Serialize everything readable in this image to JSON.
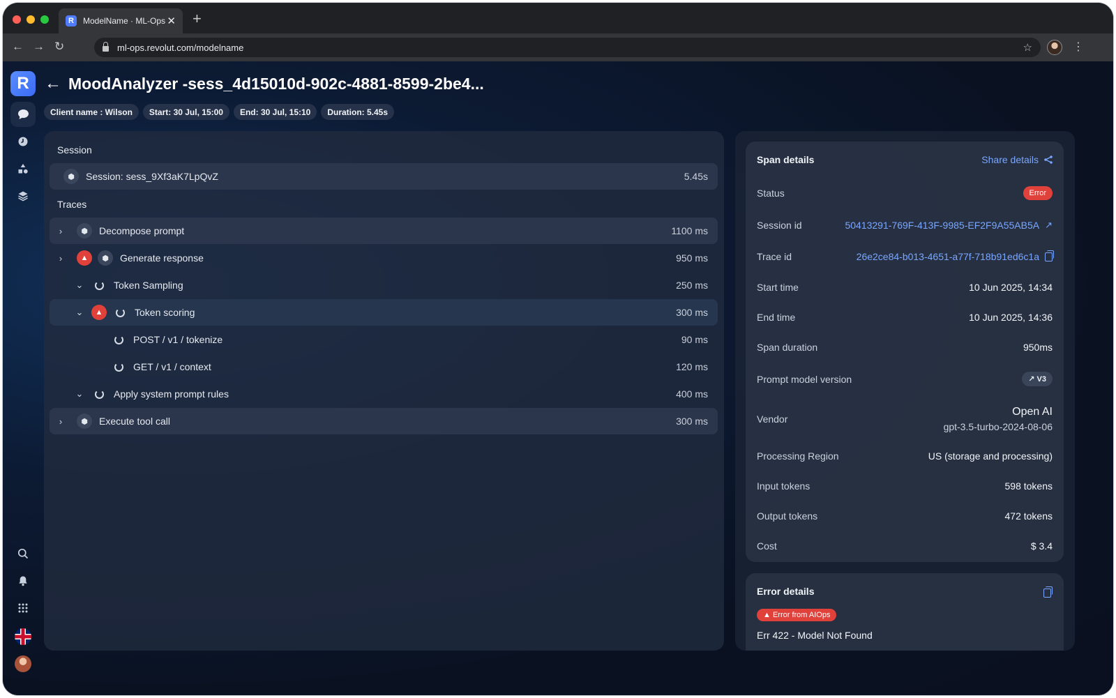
{
  "browser": {
    "tab_title": "ModelName · ML-Ops",
    "tab_favicon_letter": "R",
    "url": "ml-ops.revolut.com/modelname"
  },
  "app": {
    "logo_letter": "R",
    "title": "MoodAnalyzer -sess_4d15010d-902c-4881-8599-2be4...",
    "chips": [
      "Client name : Wilson",
      "Start: 30 Jul, 15:00",
      "End: 30 Jul, 15:10",
      "Duration: 5.45s"
    ]
  },
  "session": {
    "section_label": "Session",
    "name": "Session: sess_9Xf3aK7LpQvZ",
    "time": "5.45s"
  },
  "traces": {
    "section_label": "Traces",
    "items": [
      {
        "label": "Decompose prompt",
        "time": "1100 ms",
        "expanded": false,
        "error": false,
        "icon": "hex-icon"
      },
      {
        "label": "Generate response",
        "time": "950 ms",
        "expanded": false,
        "error": true,
        "icon": "hex-icon"
      },
      {
        "label": "Token Sampling",
        "time": "250 ms",
        "expanded": true,
        "error": false,
        "icon": "spinner-icon"
      },
      {
        "label": "Token scoring",
        "time": "300 ms",
        "expanded": true,
        "error": true,
        "icon": "spinner-icon"
      },
      {
        "label": "POST / v1 / tokenize",
        "time": "90 ms",
        "error": false,
        "icon": "spinner-icon"
      },
      {
        "label": "GET / v1 / context",
        "time": "120 ms",
        "error": false,
        "icon": "spinner-icon"
      },
      {
        "label": "Apply system prompt rules",
        "time": "400 ms",
        "expanded": true,
        "error": false,
        "icon": "spinner-icon"
      },
      {
        "label": "Execute tool call",
        "time": "300 ms",
        "expanded": false,
        "error": false,
        "icon": "hex-icon"
      }
    ]
  },
  "span_details": {
    "title": "Span details",
    "share_label": "Share details",
    "status_label": "Status",
    "status_value": "Error",
    "session_id_label": "Session id",
    "session_id_value": "50413291-769F-413F-9985-EF2F9A55AB5A",
    "trace_id_label": "Trace id",
    "trace_id_value": "26e2ce84-b013-4651-a77f-718b91ed6c1a",
    "start_time_label": "Start time",
    "start_time_value": "10 Jun 2025, 14:34",
    "end_time_label": "End time",
    "end_time_value": "10 Jun 2025, 14:36",
    "span_duration_label": "Span duration",
    "span_duration_value": "950ms",
    "prompt_version_label": "Prompt model version",
    "prompt_version_value": "V3",
    "vendor_label": "Vendor",
    "vendor_name": "Open AI",
    "vendor_model": "gpt-3.5-turbo-2024-08-06",
    "region_label": "Processing Region",
    "region_value": "US (storage and processing)",
    "input_tokens_label": "Input tokens",
    "input_tokens_value": "598 tokens",
    "output_tokens_label": "Output tokens",
    "output_tokens_value": "472 tokens",
    "cost_label": "Cost",
    "cost_value": "$ 3.4"
  },
  "error_details": {
    "title": "Error details",
    "badge": "Error from AIOps",
    "heading": "Err 422 - Model Not Found"
  },
  "colors": {
    "accent": "#79a6ff",
    "error": "#e0413b",
    "panel": "#212b3e",
    "background": "#0b1220"
  }
}
